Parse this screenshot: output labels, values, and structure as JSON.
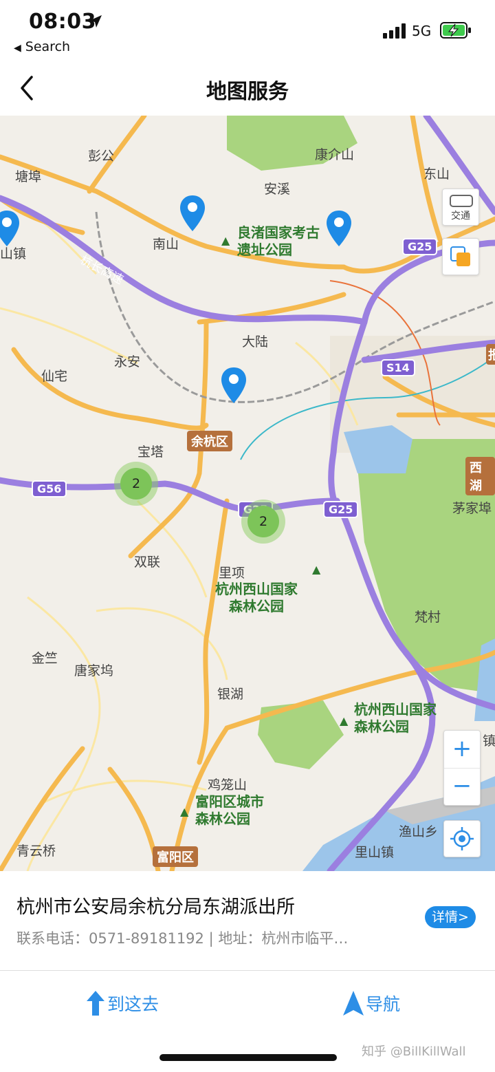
{
  "status_bar": {
    "time": "08:03",
    "back_app": "Search",
    "network": "5G"
  },
  "nav": {
    "title": "地图服务"
  },
  "map": {
    "labels": {
      "pengGong": "彭公",
      "tangBu": "塘埠",
      "kangJieShan": "康介山",
      "anXi": "安溪",
      "dongShan": "东山",
      "nanShan": "南山",
      "shanZhen": "山镇",
      "hangChang": "杭长高速",
      "liangZhu": "良渚国家考古\n遗址公园",
      "daLu": "大陆",
      "yongAn": "永安",
      "xianZhai": "仙宅",
      "baoTa": "宝塔",
      "shuangLian": "双联",
      "liXiang": "里项",
      "xishanPark1": "杭州西山国家\n森林公园",
      "maoJiaBu": "茅家埠",
      "fanCun": "梵村",
      "jinZhu": "金竺",
      "tangJiaWu": "唐家坞",
      "yinHu": "银湖",
      "xishanPark2": "杭州西山国家\n森林公园",
      "jiLongShan": "鸡笼山",
      "fuyangPark": "富阳区城市\n森林公园",
      "yuShanXiang": "渔山乡",
      "qingYunQiao": "青云桥",
      "liShanZhen": "里山镇",
      "zhen": "镇",
      "hangEdge": "报"
    },
    "shields": {
      "g25a": "G25",
      "s14": "S14",
      "g56": "G56",
      "g25b": "G25",
      "g25c": "G25"
    },
    "place_tags": {
      "yuhang": "余杭区",
      "xihu": "西湖",
      "fuyang": "富阳区"
    },
    "clusters": [
      "2",
      "2"
    ],
    "controls": {
      "traffic_label": "交通",
      "zoom_in": "+",
      "zoom_out": "−"
    }
  },
  "info": {
    "title": "杭州市公安局余杭分局东湖派出所",
    "subtitle": "联系电话：0571-89181192 | 地址：杭州市临平…",
    "details_label": "详情>"
  },
  "actions": {
    "go_here": "到这去",
    "navigate": "导航"
  },
  "watermark": "知乎 @BillKillWall",
  "colors": {
    "accent": "#2d8ee6",
    "pin": "#1e8be6",
    "highway": "#9b7fe0",
    "road": "#f5b94f",
    "park": "#a9d47f",
    "water": "#9cc5ea"
  }
}
